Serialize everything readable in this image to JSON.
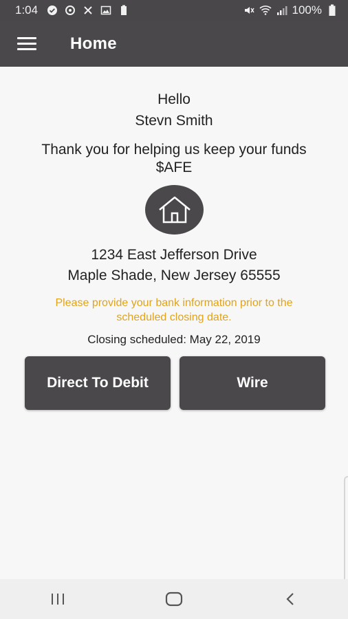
{
  "status_bar": {
    "time": "1:04",
    "battery": "100%",
    "icons": [
      "check-circle-icon",
      "sync-icon",
      "x-icon",
      "image-icon",
      "battery-small-icon",
      "mute-icon",
      "wifi-icon",
      "signal-icon",
      "battery-icon"
    ]
  },
  "app_bar": {
    "title": "Home"
  },
  "main": {
    "greeting": "Hello",
    "name": "Stevn Smith",
    "thanks": "Thank you for helping us keep your funds $AFE",
    "address_line1": "1234 East Jefferson Drive",
    "address_line2": "Maple Shade, New Jersey 65555",
    "notice": "Please provide your bank information prior to the scheduled closing date.",
    "closing": "Closing scheduled: May 22, 2019"
  },
  "buttons": {
    "debit_label": "Direct To Debit",
    "wire_label": "Wire"
  },
  "colors": {
    "primary": "#4a484b",
    "notice": "#e1a31b",
    "background": "#f7f7f7"
  }
}
